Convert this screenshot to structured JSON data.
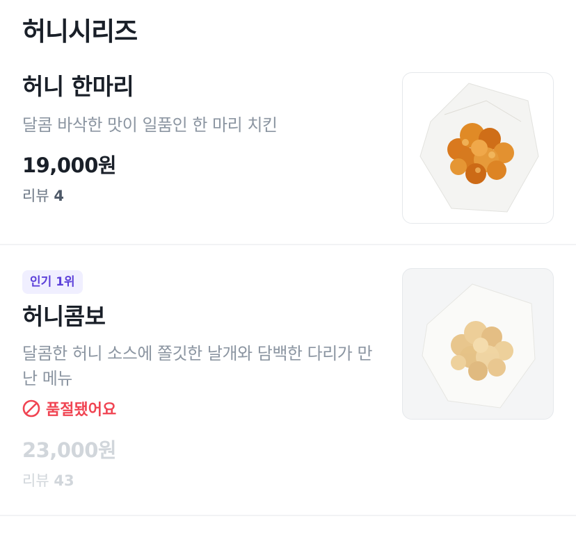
{
  "section": {
    "title": "허니시리즈"
  },
  "items": [
    {
      "name": "허니 한마리",
      "description": "달콤 바삭한 맛이 일품인 한 마리 치킨",
      "price": "19,000원",
      "review_label": "리뷰",
      "review_count": "4",
      "image_icon": "fried-chicken-image"
    },
    {
      "badge": "인기 1위",
      "name": "허니콤보",
      "description": "달콤한 허니 소스에 쫄깃한 날개와 담백한 다리가 만난 메뉴",
      "status": "품절됐어요",
      "price": "23,000원",
      "review_label": "리뷰",
      "review_count": "43",
      "image_icon": "fried-chicken-image"
    }
  ],
  "colors": {
    "title": "#191f28",
    "description": "#8b95a1",
    "badge_bg": "#f0efff",
    "badge_text": "#5b3fd9",
    "soldout": "#f04452",
    "disabled": "#d1d6db",
    "divider": "#f2f3f5"
  }
}
